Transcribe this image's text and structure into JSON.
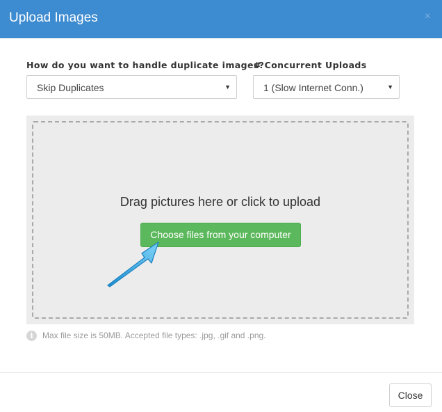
{
  "header": {
    "title": "Upload Images",
    "close_glyph": "×",
    "background_color": "#3d8bd0"
  },
  "duplicates": {
    "label": "How do you want to handle duplicate images?",
    "selected": "Skip Duplicates"
  },
  "concurrency": {
    "label": "# Concurrent Uploads",
    "selected": "1 (Slow Internet Conn.)"
  },
  "dropzone": {
    "prompt": "Drag pictures here or click to upload",
    "button_label": "Choose files from your computer",
    "button_color": "#5cb85c"
  },
  "hint": {
    "icon": "info-icon",
    "glyph": "i",
    "text": "Max file size is 50MB. Accepted file types: .jpg, .gif and .png."
  },
  "footer": {
    "close_label": "Close"
  },
  "annotation": {
    "icon": "pointer-arrow-icon",
    "color": "#29a3e0"
  }
}
